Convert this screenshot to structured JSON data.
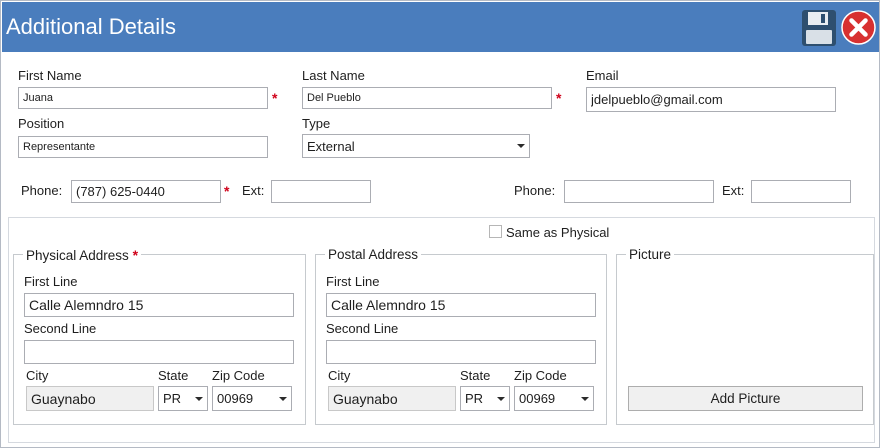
{
  "window": {
    "title": "Additional Details"
  },
  "toolbar": {
    "save_icon": "floppy-disk-icon",
    "close_icon": "close-icon",
    "close_color": "#d83030"
  },
  "colors": {
    "titlebar": "#4a7dbd",
    "required": "#d0021b"
  },
  "contact": {
    "first_name": {
      "label": "First Name",
      "value": "Juana",
      "required_mark": "*"
    },
    "last_name": {
      "label": "Last Name",
      "value": "Del Pueblo",
      "required_mark": "*"
    },
    "email": {
      "label": "Email",
      "value": "jdelpueblo@gmail.com"
    },
    "position": {
      "label": "Position",
      "value": "Representante"
    },
    "type": {
      "label": "Type",
      "value": "External"
    }
  },
  "phones": {
    "primary": {
      "label": "Phone:",
      "value": "(787) 625-0440",
      "required_mark": "*",
      "ext_label": "Ext:",
      "ext_value": ""
    },
    "secondary": {
      "label": "Phone:",
      "value": "",
      "ext_label": "Ext:",
      "ext_value": ""
    }
  },
  "same_as_physical": {
    "label": "Same as Physical",
    "checked": false
  },
  "physical": {
    "legend": "Physical Address",
    "required_mark": "*",
    "first_line_label": "First Line",
    "first_line": "Calle Alemndro 15",
    "second_line_label": "Second Line",
    "second_line": "",
    "city_label": "City",
    "city": "Guaynabo",
    "state_label": "State",
    "state": "PR",
    "zip_label": "Zip Code",
    "zip": "00969"
  },
  "postal": {
    "legend": "Postal Address",
    "first_line_label": "First Line",
    "first_line": "Calle Alemndro 15",
    "second_line_label": "Second Line",
    "second_line": "",
    "city_label": "City",
    "city": "Guaynabo",
    "state_label": "State",
    "state": "PR",
    "zip_label": "Zip Code",
    "zip": "00969"
  },
  "picture": {
    "legend": "Picture",
    "button_label": "Add Picture"
  }
}
